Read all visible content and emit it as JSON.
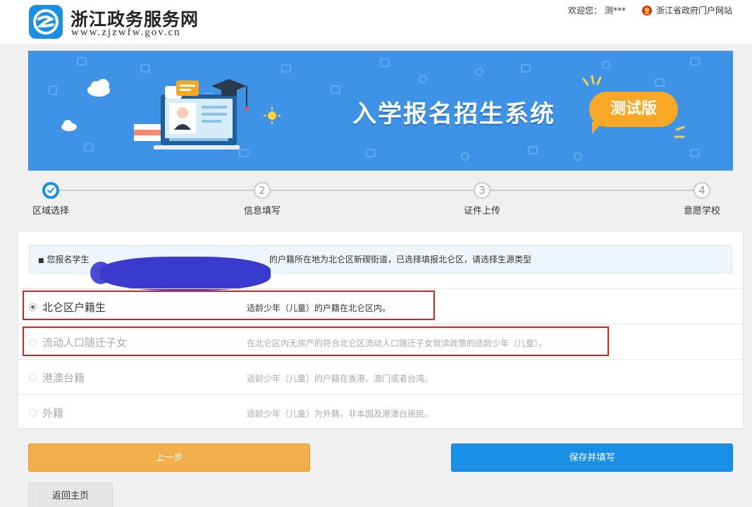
{
  "header": {
    "site_name": "浙江政务服务网",
    "site_url": "www.zjzwfw.gov.cn",
    "welcome": "欢迎您：",
    "user_name": "测***",
    "portal_link": "浙江省政府门户网站"
  },
  "banner": {
    "title": "入学报名招生系统",
    "badge": "测试版"
  },
  "steps": [
    {
      "number": "1",
      "label": "区域选择",
      "state": "active"
    },
    {
      "number": "2",
      "label": "信息填写",
      "state": "pending"
    },
    {
      "number": "3",
      "label": "证件上传",
      "state": "pending"
    },
    {
      "number": "4",
      "label": "意愿学校",
      "state": "pending"
    }
  ],
  "notice": {
    "prefix": "您报名学生",
    "text": "的户籍所在地为北仑区新碶街道，已选择填报北仑区，请选择生源类型"
  },
  "options": [
    {
      "label": "北仑区户籍生",
      "desc": "适龄少年（儿童）的户籍在北仑区内。",
      "checked": true,
      "enabled": true
    },
    {
      "label": "流动人口随迁子女",
      "desc": "在北仑区内无房产的符合北仑区流动人口随迁子女就读政策的适龄少年（儿童）。",
      "checked": false,
      "enabled": false
    },
    {
      "label": "港澳台籍",
      "desc": "适龄少年（儿童）的户籍在香港、澳门或者台湾。",
      "checked": false,
      "enabled": false
    },
    {
      "label": "外籍",
      "desc": "适龄少年（儿童）为外籍，非本国及港澳台居民。",
      "checked": false,
      "enabled": false
    }
  ],
  "buttons": {
    "prev": "上一步",
    "save": "保存并填写",
    "home": "返回主页"
  },
  "colors": {
    "primary": "#1a8fe6",
    "prev_button": "#f2b04c",
    "badge": "#f9a826",
    "banner": "#3f93e6",
    "highlight_border": "#e02020"
  }
}
